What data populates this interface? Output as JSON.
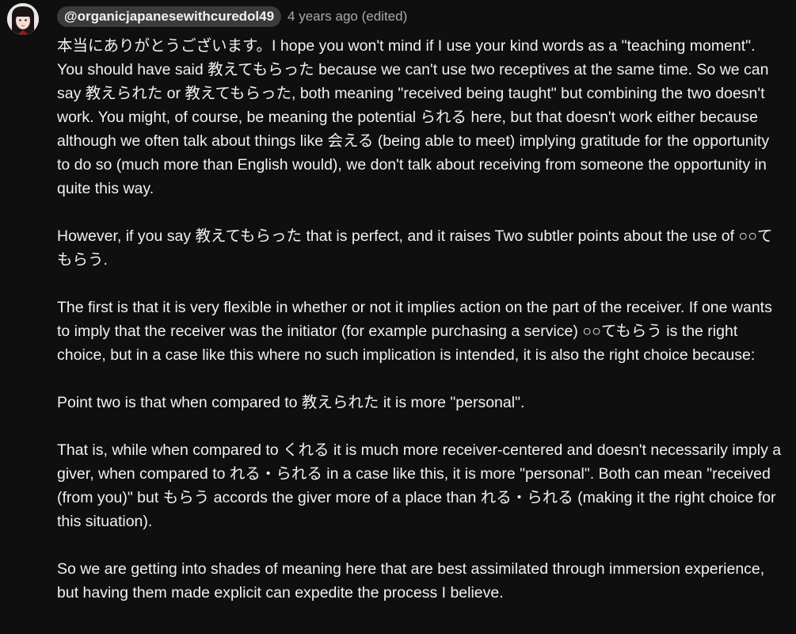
{
  "comment": {
    "author": "@organicjapanesewithcuredol49",
    "timestamp": "4 years ago (edited)",
    "paragraphs": [
      "本当にありがとうございます。I hope you won't mind if I use your kind words as a \"teaching moment\". You should have said 教えてもらった because we can't use two receptives at the same time. So we can say 教えられた or 教えてもらった, both meaning \"received being taught\" but combining the two doesn't work. You might, of course, be meaning the potential られる here, but that doesn't work either because although we often talk about things like 会える (being able to meet) implying gratitude for the opportunity to do so (much more than English would), we don't talk about receiving from someone the opportunity in quite this way.",
      "However, if you say 教えてもらった that is perfect, and it raises Two subtler points about the use of ○○てもらう.",
      "The first is that it is very flexible in whether or not it implies action on the part of the receiver. If one wants to imply that the receiver was the initiator (for example purchasing a service) ○○てもらう is the right choice, but in a case like this where no such implication is intended, it is also the right choice because:",
      "Point two is that when compared to 教えられた it is more \"personal\".",
      "That is, while when compared to くれる it is much more receiver-centered and doesn't necessarily imply a giver, when compared to れる・られる in a case like this, it is more \"personal\". Both can mean \"received (from you)\" but もらう accords the giver more of a place than れる・られる (making it the right choice for this situation).",
      "So we are getting into shades of meaning here that are best assimilated through immersion experience, but having them made explicit can expedite the process I believe."
    ]
  },
  "colors": {
    "background": "#0f0f0f",
    "text": "#f1f1f1",
    "secondary_text": "#aaaaaa",
    "author_chip": "#3b3b3b"
  },
  "icons": {
    "avatar": "avatar-icon"
  }
}
